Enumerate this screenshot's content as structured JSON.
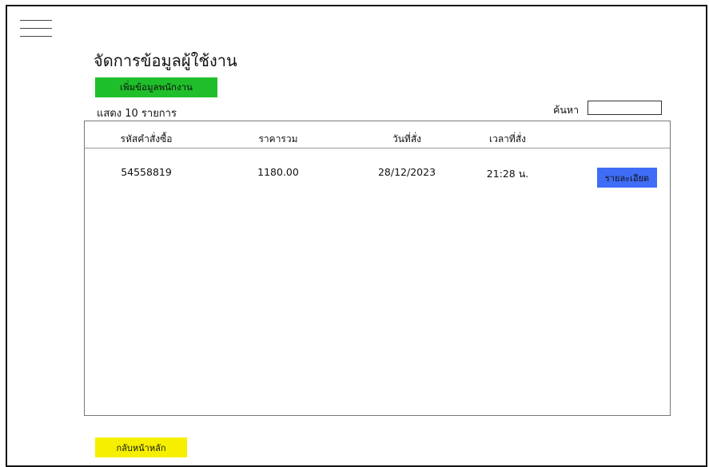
{
  "header": {
    "menu_icon": "hamburger-menu-icon",
    "title": "จัดการข้อมูลผู้ใช้งาน"
  },
  "toolbar": {
    "add_label": "เพิ่มข้อมูลพนักงาน",
    "show_count_label": "แสดง 10 รายการ",
    "search_label": "ค้นหา",
    "search_value": ""
  },
  "table": {
    "columns": [
      "รหัสคำสั่งซื้อ",
      "ราคารวม",
      "วันที่สั่ง",
      "เวลาที่สั่ง"
    ],
    "rows": [
      {
        "order_id": "54558819",
        "total": "1180.00",
        "date": "28/12/2023",
        "time": "21:28 น.",
        "action_label": "รายละเอียด"
      }
    ]
  },
  "footer": {
    "back_label": "กลับหน้าหลัก"
  },
  "colors": {
    "add_button": "#1fbf2b",
    "detail_button": "#3f6df7",
    "back_button": "#f6f000"
  }
}
